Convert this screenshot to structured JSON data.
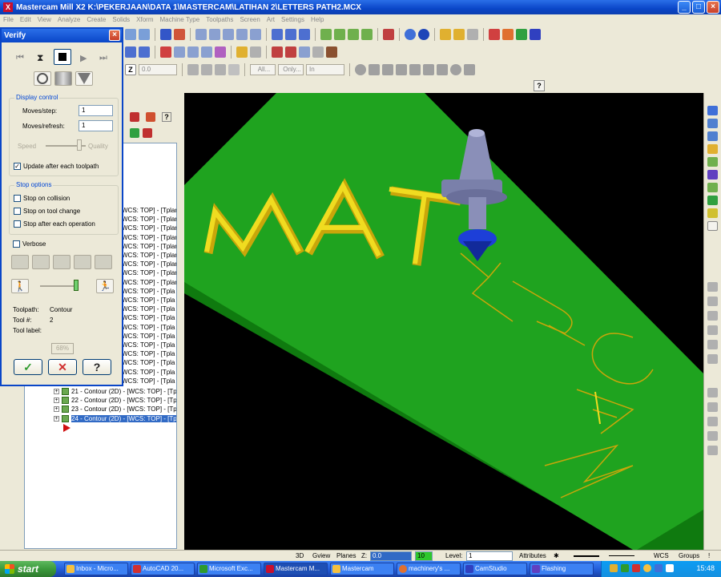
{
  "window": {
    "title": "Mastercam Mill X2  K:\\PEKERJAAN\\DATA 1\\MASTERCAM\\LATIHAN 2\\LETTERS PATH2.MCX"
  },
  "menu": [
    "File",
    "Edit",
    "View",
    "Analyze",
    "Create",
    "Solids",
    "Xform",
    "Machine Type",
    "Toolpaths",
    "Screen",
    "Art",
    "Settings",
    "Help"
  ],
  "toolbar": {
    "z_value": "0.0",
    "all_label": "All...",
    "only_label": "Only...",
    "in_label": "In"
  },
  "verify": {
    "title": "Verify",
    "display_control": "Display control",
    "moves_step_label": "Moves/step:",
    "moves_step_value": "1",
    "moves_refresh_label": "Moves/refresh:",
    "moves_refresh_value": "1",
    "speed_label": "Speed",
    "quality_label": "Quality",
    "update_label": "Update after each toolpath",
    "update_checked": true,
    "stop_options": "Stop options",
    "stop_collision": "Stop on collision",
    "stop_tool_change": "Stop on tool change",
    "stop_each_operation": "Stop after each operation",
    "verbose": "Verbose",
    "toolpath_label": "Toolpath:",
    "toolpath_value": "Contour",
    "tool_label": "Tool #:",
    "tool_value": "2",
    "tool_label_label": "Tool label:",
    "progress": "68%"
  },
  "tree": {
    "partial_rows": [
      "WCS: TOP] - [Tplar",
      "WCS: TOP] - [Tplar",
      "WCS: TOP] - [Tplar",
      "WCS: TOP] - [Tplar",
      "WCS: TOP] - [Tplar",
      "WCS: TOP] - [Tplar",
      "WCS: TOP] - [Tplar",
      "WCS: TOP] - [Tplar",
      "WCS: TOP] - [Tplar",
      "WCS: TOP] - [Tpla",
      "WCS: TOP] - [Tpla",
      "WCS: TOP] - [Tpla",
      "WCS: TOP] - [Tpla",
      "WCS: TOP] - [Tpla",
      "WCS: TOP] - [Tpla",
      "WCS: TOP] - [Tpla",
      "WCS: TOP] - [Tpla",
      "WCS: TOP] - [Tpla",
      "WCS: TOP] - [Tpla",
      "WCS: TOP] - [Tpla"
    ],
    "full_rows": [
      "21 - Contour (2D) - [WCS: TOP] - [Tpla",
      "22 - Contour (2D) - [WCS: TOP] - [Tpla",
      "23 - Contour (2D) - [WCS: TOP] - [Tpla",
      "24 - Contour (2D) - [WCS: TOP] - [Tpla"
    ]
  },
  "statusbar": {
    "mode_3d": "3D",
    "gview": "Gview",
    "planes": "Planes",
    "z_label": "Z:",
    "z_value": "0.0",
    "color_value": "10",
    "level_label": "Level:",
    "level_value": "1",
    "attributes": "Attributes",
    "wcs": "WCS",
    "groups": "Groups",
    "bang": "!"
  },
  "taskbar": {
    "start": "start",
    "tasks": [
      "Inbox - Micro...",
      "AutoCAD 20...",
      "Microsoft Exc...",
      "Mastercam M...",
      "Mastercam",
      "machinery's ...",
      "CamStudio",
      "Flashing"
    ],
    "clock": "15:48"
  },
  "colors": {
    "plate": "#1fa31f",
    "letters": "#e8d20a",
    "tool_body": "#8a8fb8",
    "tool_tip": "#1d3fd8"
  }
}
